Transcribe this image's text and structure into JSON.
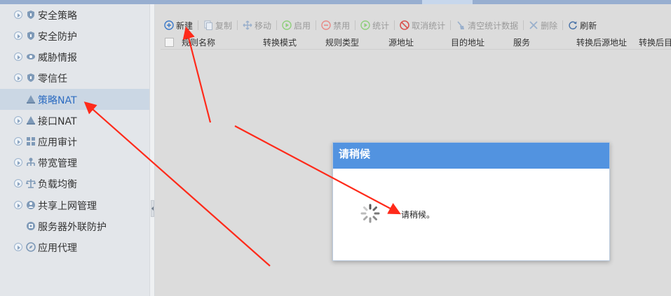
{
  "sidebar": {
    "items": [
      {
        "label": "安全策略",
        "icon": "shield-icon"
      },
      {
        "label": "安全防护",
        "icon": "shield-icon"
      },
      {
        "label": "威胁情报",
        "icon": "eye-icon"
      },
      {
        "label": "零信任",
        "icon": "shield-icon"
      },
      {
        "label": "策略NAT",
        "icon": "nat-icon",
        "active": true
      },
      {
        "label": "接口NAT",
        "icon": "nat-icon"
      },
      {
        "label": "应用审计",
        "icon": "grid-icon"
      },
      {
        "label": "带宽管理",
        "icon": "hierarchy-icon"
      },
      {
        "label": "负载均衡",
        "icon": "balance-icon"
      },
      {
        "label": "共享上网管理",
        "icon": "share-icon"
      },
      {
        "label": "服务器外联防护",
        "icon": "server-icon"
      },
      {
        "label": "应用代理",
        "icon": "compass-icon"
      }
    ]
  },
  "toolbar": {
    "new_label": "新建",
    "copy_label": "复制",
    "move_label": "移动",
    "enable_label": "启用",
    "disable_label": "禁用",
    "stats_label": "统计",
    "cancel_stats_label": "取消统计",
    "clear_stats_label": "清空统计数据",
    "delete_label": "删除",
    "refresh_label": "刷新"
  },
  "grid": {
    "columns": [
      "规则名称",
      "转换模式",
      "规则类型",
      "源地址",
      "目的地址",
      "服务",
      "转换后源地址",
      "转换后目"
    ]
  },
  "dialog": {
    "title": "请稍候",
    "message": "请稍候。"
  },
  "colors": {
    "accent": "#5293e0",
    "annotation_arrow": "#ff2a1a",
    "active_item_text": "#2d6cc1"
  }
}
